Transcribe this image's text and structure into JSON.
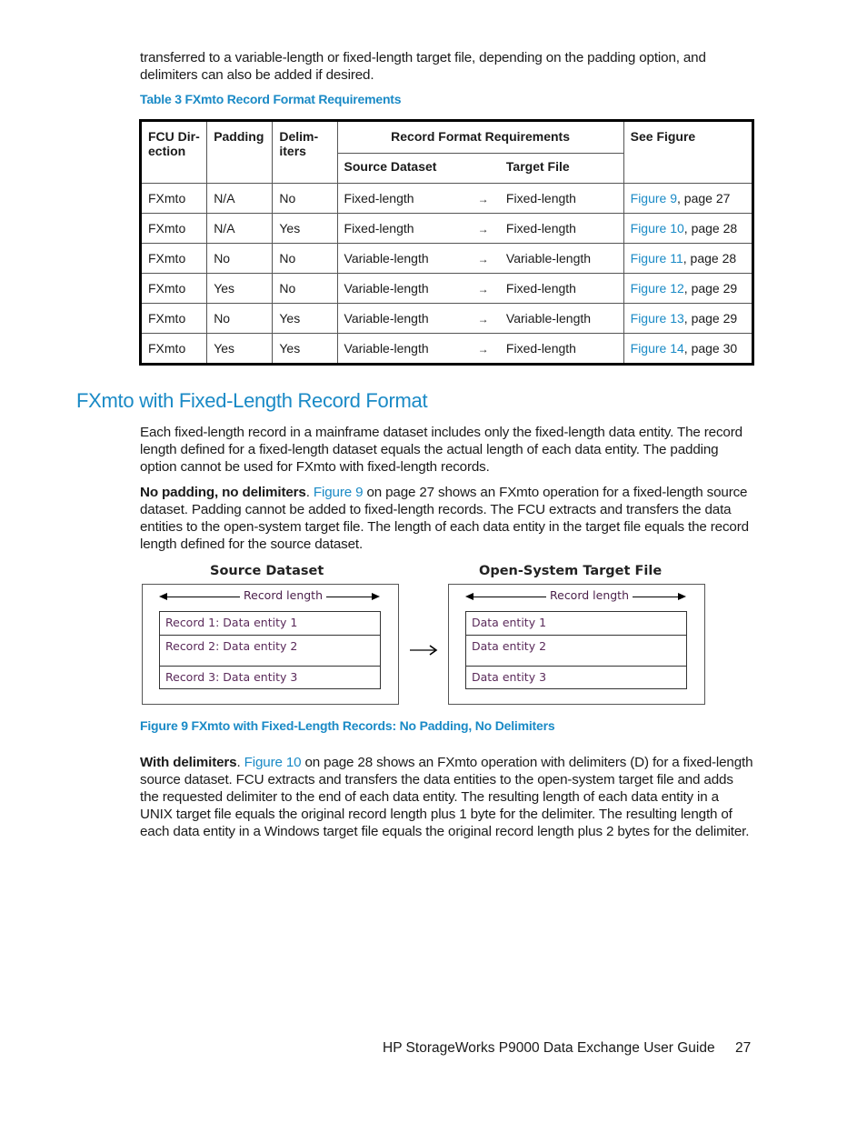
{
  "intro_paragraph": "transferred to a variable-length or fixed-length target file, depending on the padding option, and delimiters can also be added if desired.",
  "table": {
    "caption": "Table 3 FXmto Record Format Requirements",
    "headers": {
      "fcu_direction": "FCU Dir- ection",
      "padding": "Padding",
      "delimiters": "Delim- iters",
      "record_format_requirements": "Record Format Requirements",
      "source_dataset": "Source Dataset",
      "target_file": "Target File",
      "see_figure": "See Figure"
    },
    "arrow_icon": "right-arrow-icon",
    "rows": [
      {
        "direction": "FXmto",
        "padding": "N/A",
        "delimiters": "No",
        "source": "Fixed-length",
        "arrow": "→",
        "target": "Fixed-length",
        "figure_link": "Figure 9",
        "page": ", page 27"
      },
      {
        "direction": "FXmto",
        "padding": "N/A",
        "delimiters": "Yes",
        "source": "Fixed-length",
        "arrow": "→",
        "target": "Fixed-length",
        "figure_link": "Figure 10",
        "page": ", page 28"
      },
      {
        "direction": "FXmto",
        "padding": "No",
        "delimiters": "No",
        "source": "Variable-length",
        "arrow": "→",
        "target": "Variable-length",
        "figure_link": "Figure 11",
        "page": ", page 28"
      },
      {
        "direction": "FXmto",
        "padding": "Yes",
        "delimiters": "No",
        "source": "Variable-length",
        "arrow": "→",
        "target": "Fixed-length",
        "figure_link": "Figure 12",
        "page": ", page 29"
      },
      {
        "direction": "FXmto",
        "padding": "No",
        "delimiters": "Yes",
        "source": "Variable-length",
        "arrow": "→",
        "target": "Variable-length",
        "figure_link": "Figure 13",
        "page": ", page 29"
      },
      {
        "direction": "FXmto",
        "padding": "Yes",
        "delimiters": "Yes",
        "source": "Variable-length",
        "arrow": "→",
        "target": "Fixed-length",
        "figure_link": "Figure 14",
        "page": ", page 30"
      }
    ]
  },
  "section": {
    "title": "FXmto with Fixed-Length Record Format",
    "paragraph1": "Each fixed-length record in a mainframe dataset includes only the fixed-length data entity. The record length defined for a fixed-length dataset equals the actual length of each data entity. The padding option cannot be used for FXmto with fixed-length records.",
    "paragraph2": {
      "bold_lead": "No padding, no delimiters",
      "after_bold": ". ",
      "link": "Figure 9",
      "rest": " on page 27 shows an FXmto operation for a fixed-length source dataset. Padding cannot be added to fixed-length records. The FCU extracts and transfers the data entities to the open-system target file. The length of each data entity in the target file equals the record length defined for the source dataset."
    },
    "paragraph3": {
      "bold_lead": "With delimiters",
      "after_bold": ". ",
      "link": "Figure 10",
      "rest": " on page 28 shows an FXmto operation with delimiters (D) for a fixed-length source dataset. FCU extracts and transfers the data entities to the open-system target file and adds the requested delimiter to the end of each data entity. The resulting length of each data entity in a UNIX target file equals the original record length plus 1 byte for the delimiter. The resulting length of each data entity in a Windows target file equals the original record length plus 2 bytes for the delimiter."
    }
  },
  "figure": {
    "caption": "Figure 9 FXmto with Fixed-Length Records: No Padding, No Delimiters",
    "source": {
      "title": "Source Dataset",
      "record_length_label": "Record length",
      "rows": [
        "Record 1: Data entity 1",
        "Record 2: Data entity 2",
        "Record 3: Data entity 3"
      ]
    },
    "transfer_arrow_icon": "right-arrow-icon",
    "target": {
      "title": "Open-System Target File",
      "record_length_label": "Record length",
      "rows": [
        "Data entity 1",
        "Data entity 2",
        "Data entity 3"
      ]
    }
  },
  "footer": {
    "guide_title": "HP StorageWorks P9000 Data Exchange User Guide",
    "page_number": "27"
  }
}
